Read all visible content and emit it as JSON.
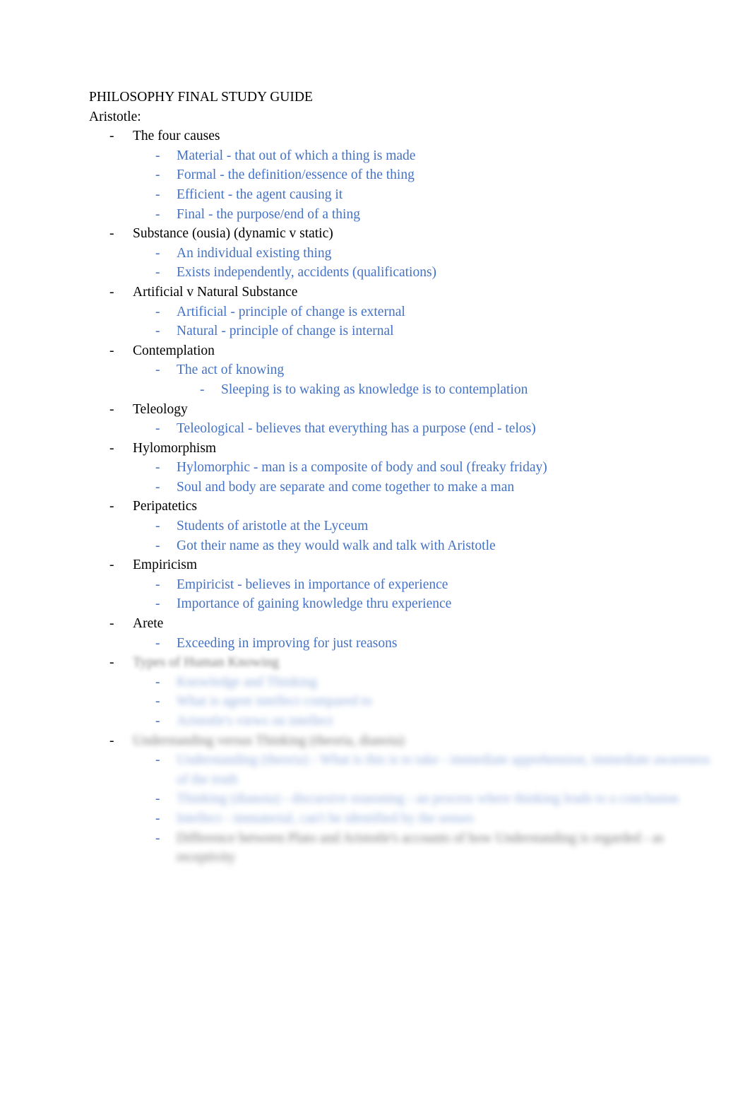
{
  "document": {
    "title": "PHILOSOPHY FINAL STUDY GUIDE",
    "lead": "Aristotle:",
    "accent_color": "#4472c4",
    "text_color": "#000000",
    "background_color": "#ffffff",
    "bullet_marker": "-"
  },
  "outline": [
    {
      "level": 1,
      "text": "The four causes",
      "children": [
        {
          "level": 2,
          "text": "Material - that out of which a thing is made"
        },
        {
          "level": 2,
          "text": "Formal - the definition/essence of the thing"
        },
        {
          "level": 2,
          "text": "Efficient - the agent causing it"
        },
        {
          "level": 2,
          "text": "Final - the purpose/end of a thing"
        }
      ]
    },
    {
      "level": 1,
      "text": "Substance (ousia) (dynamic v static)",
      "children": [
        {
          "level": 2,
          "text": "An individual existing thing"
        },
        {
          "level": 2,
          "text": "Exists independently, accidents (qualifications)"
        }
      ]
    },
    {
      "level": 1,
      "text": "Artificial v Natural Substance",
      "children": [
        {
          "level": 2,
          "text": "Artificial - principle of change is external"
        },
        {
          "level": 2,
          "text": "Natural - principle of change is internal"
        }
      ]
    },
    {
      "level": 1,
      "text": "Contemplation",
      "children": [
        {
          "level": 2,
          "text": "The act of knowing"
        },
        {
          "level": 3,
          "text": "Sleeping is to waking as knowledge is to contemplation"
        }
      ]
    },
    {
      "level": 1,
      "text": "Teleology",
      "children": [
        {
          "level": 2,
          "text": "Teleological - believes that everything has a purpose (end - telos)"
        }
      ]
    },
    {
      "level": 1,
      "text": "Hylomorphism",
      "children": [
        {
          "level": 2,
          "text": "Hylomorphic - man is a composite of body and soul (freaky friday)"
        },
        {
          "level": 2,
          "text": "Soul and body are separate and come together to make a man"
        }
      ]
    },
    {
      "level": 1,
      "text": "Peripatetics",
      "children": [
        {
          "level": 2,
          "text": "Students of aristotle at the Lyceum"
        },
        {
          "level": 2,
          "text": "Got their name as they would walk and talk with Aristotle"
        }
      ]
    },
    {
      "level": 1,
      "text": "Empiricism",
      "children": [
        {
          "level": 2,
          "text": "Empiricist - believes in importance of experience"
        },
        {
          "level": 2,
          "text": "Importance of gaining knowledge thru experience"
        }
      ]
    },
    {
      "level": 1,
      "text": "Arete",
      "children": [
        {
          "level": 2,
          "text": "Exceeding in improving for just reasons"
        }
      ]
    }
  ],
  "obscured_section": {
    "note": "Lower portion of the page is rendered out of focus and is not legible.",
    "items": [
      {
        "level": 1,
        "tone": "dark",
        "text": "Types of Human Knowing"
      },
      {
        "level": 2,
        "tone": "accent",
        "text": "Knowledge and Thinking"
      },
      {
        "level": 2,
        "tone": "accent",
        "text": "What is agent intellect compared to"
      },
      {
        "level": 2,
        "tone": "accent",
        "text": "Aristotle's views on intellect"
      },
      {
        "level": 1,
        "tone": "dark",
        "text": "Understanding versus Thinking (theoria, dianoia)"
      },
      {
        "level": 2,
        "tone": "accent",
        "text": "Understanding (theoria) - What is this is to take - immediate apprehension, immediate awareness of the truth"
      },
      {
        "level": 2,
        "tone": "accent",
        "text": "Thinking (dianoia) - discursive reasoning - an process where thinking leads to a conclusion"
      },
      {
        "level": 2,
        "tone": "accent",
        "text": "Intellect - immaterial, can't be identified by the senses"
      },
      {
        "level": 2,
        "tone": "dark",
        "text": "Difference between Plato and Aristotle's accounts of how Understanding is regarded - as receptivity"
      }
    ]
  }
}
